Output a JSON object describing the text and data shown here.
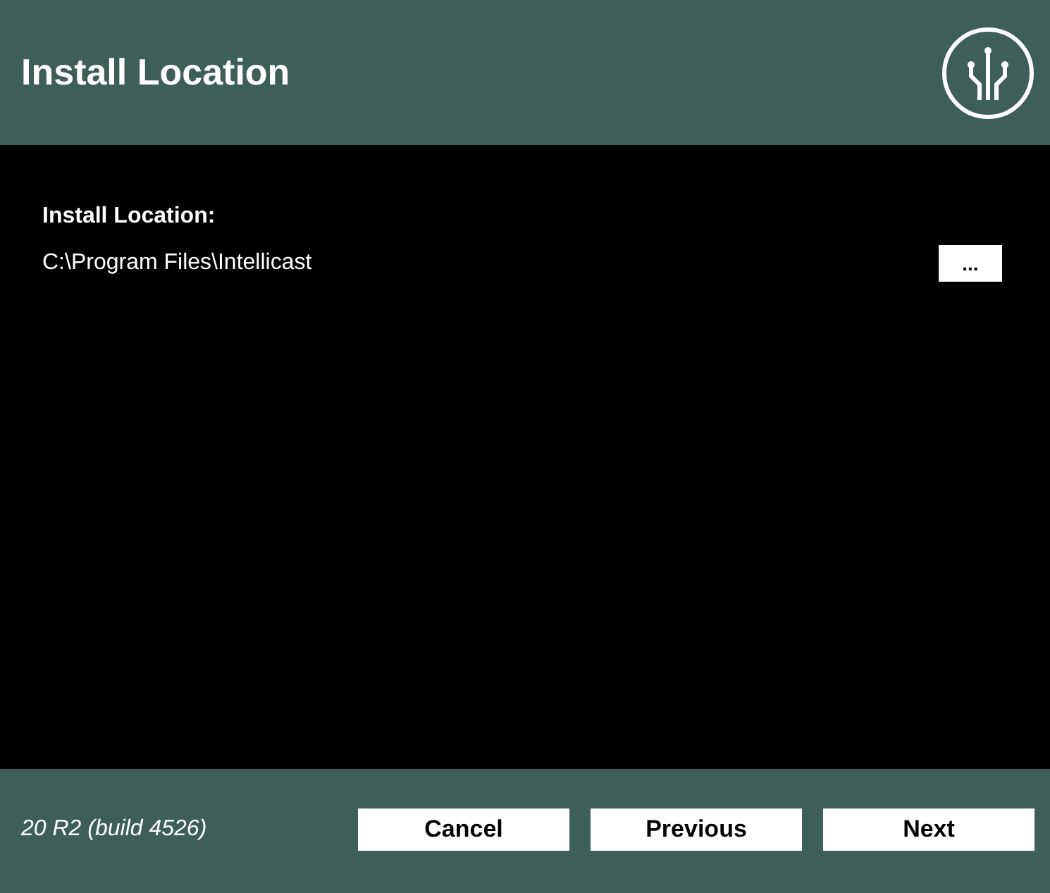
{
  "header": {
    "title": "Install Location"
  },
  "location": {
    "label": "Install Location:",
    "path": "C:\\Program Files\\Intellicast",
    "browse_button": "..."
  },
  "footer": {
    "version": "20 R2 (build 4526)",
    "buttons": [
      "Cancel",
      "Previous",
      "Next"
    ]
  }
}
